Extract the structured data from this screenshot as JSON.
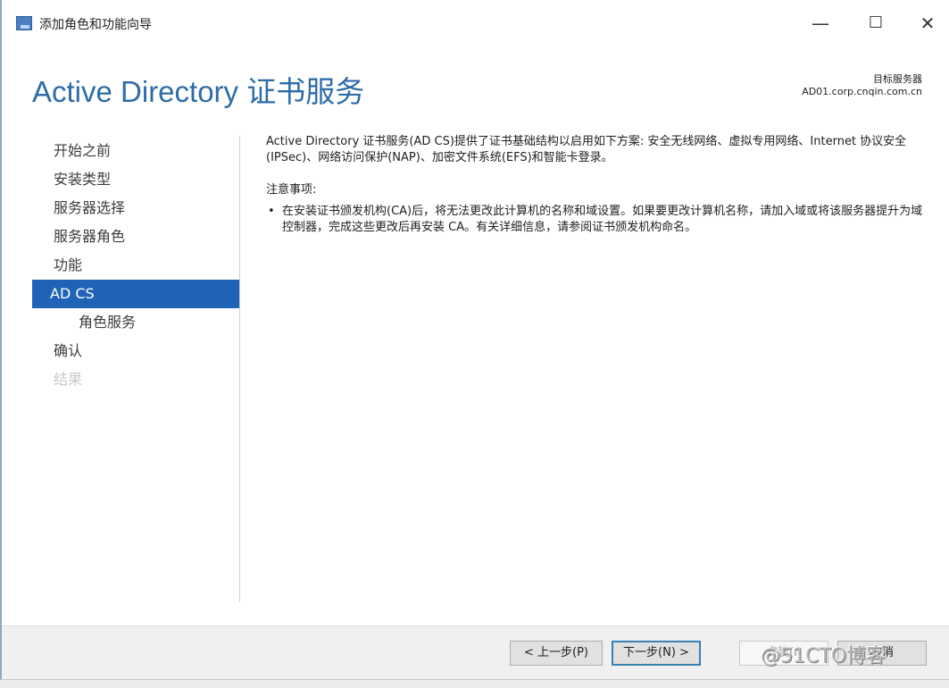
{
  "window": {
    "title": "添加角色和功能向导",
    "minimize_glyph": "—",
    "maximize_glyph": "☐",
    "close_glyph": "✕"
  },
  "header": {
    "page_title": "Active Directory 证书服务",
    "target_label": "目标服务器",
    "target_server": "AD01.corp.cnqin.com.cn"
  },
  "nav": {
    "items": [
      {
        "label": "开始之前",
        "state": "normal"
      },
      {
        "label": "安装类型",
        "state": "normal"
      },
      {
        "label": "服务器选择",
        "state": "normal"
      },
      {
        "label": "服务器角色",
        "state": "normal"
      },
      {
        "label": "功能",
        "state": "normal"
      },
      {
        "label": "AD CS",
        "state": "active"
      },
      {
        "label": "角色服务",
        "state": "sub"
      },
      {
        "label": "确认",
        "state": "normal"
      },
      {
        "label": "结果",
        "state": "disabled"
      }
    ]
  },
  "content": {
    "intro": "Active Directory 证书服务(AD CS)提供了证书基础结构以启用如下方案: 安全无线网络、虚拟专用网络、Internet 协议安全(IPSec)、网络访问保护(NAP)、加密文件系统(EFS)和智能卡登录。",
    "notes_title": "注意事项:",
    "notes": [
      "在安装证书颁发机构(CA)后，将无法更改此计算机的名称和域设置。如果要更改计算机名称，请加入域或将该服务器提升为域控制器，完成这些更改后再安装 CA。有关详细信息，请参阅证书颁发机构命名。"
    ]
  },
  "footer": {
    "prev_label": "< 上一步(P)",
    "next_label": "下一步(N) >",
    "install_label": "安装(I)",
    "cancel_label": "取消"
  },
  "watermark": "@51CTO博客",
  "colors": {
    "accent": "#1f63b6",
    "title": "#2e6ca8"
  }
}
